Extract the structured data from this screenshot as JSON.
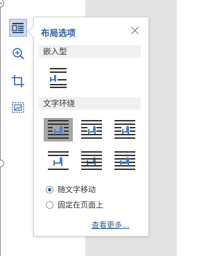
{
  "panel": {
    "title": "布局选项",
    "inline_section": "嵌入型",
    "wrap_section": "文字环绕",
    "inline_options": [
      {
        "name": "inline"
      }
    ],
    "wrap_options": [
      {
        "name": "square",
        "selected": true
      },
      {
        "name": "tight",
        "selected": false
      },
      {
        "name": "through",
        "selected": false
      },
      {
        "name": "top-bottom",
        "selected": false
      },
      {
        "name": "behind-text",
        "selected": false
      },
      {
        "name": "in-front-of-text",
        "selected": false
      }
    ],
    "radio_options": [
      {
        "label": "随文字移动",
        "checked": true
      },
      {
        "label": "固定在页面上",
        "checked": false
      }
    ],
    "more_link": "查看更多..."
  },
  "side_toolbar": [
    {
      "name": "layout-options-icon",
      "active": true
    },
    {
      "name": "zoom-in-icon",
      "active": false
    },
    {
      "name": "crop-icon",
      "active": false
    },
    {
      "name": "picture-frame-icon",
      "active": false
    }
  ],
  "colors": {
    "accent": "#2f5fa0",
    "horse": "#3f7fd0",
    "selected_bg": "#a6a6a6"
  }
}
